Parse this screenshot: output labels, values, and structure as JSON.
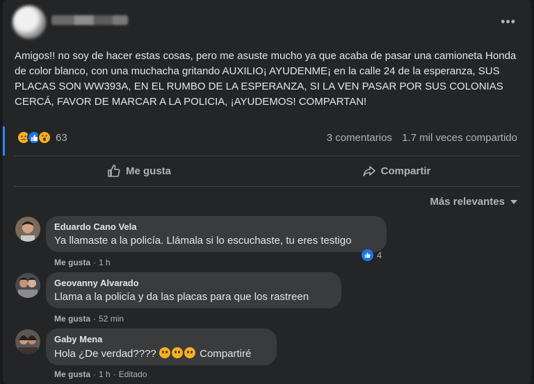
{
  "post": {
    "text": "Amigos!! no soy de hacer estas cosas, pero me asuste mucho ya que acaba de pasar una camioneta Honda de color blanco, con una muchacha gritando AUXILIO¡ AYUDENME¡ en la calle 24 de la esperanza, SUS PLACAS SON WW393A, EN EL RUMBO DE LA ESPERANZA, SI LA VEN PASAR POR SUS COLONIAS CERCÁ, FAVOR DE MARCAR A LA POLICIA, ¡AYUDEMOS! COMPARTAN!",
    "more_label": "•••",
    "reaction_count": "63",
    "comments_count": "3 comentarios",
    "shares_count": "1.7 mil veces compartido"
  },
  "actions": {
    "like_label": "Me gusta",
    "share_label": "Compartir"
  },
  "sort": {
    "label": "Más relevantes"
  },
  "comments": [
    {
      "name": "Eduardo Cano Vela",
      "text": "Ya llamaste a la policía. Llámala si lo escuchaste, tu eres testigo",
      "like": "Me gusta",
      "time": "1 h",
      "reactions": "4"
    },
    {
      "name": "Geovanny Alvarado",
      "text": "Llama a la policía y da las placas para que los rastreen",
      "like": "Me gusta",
      "time": "52 min"
    },
    {
      "name": "Gaby Mena",
      "text_before": "Hola ¿De verdad????",
      "text_after": "Compartiré",
      "like": "Me gusta",
      "time": "1 h",
      "edited": "Editado"
    }
  ],
  "colors": {
    "accent": "#2d88ff",
    "like_blue": "#1877f2",
    "emoji_yellow": "#f7b125"
  },
  "icons": [
    "more-icon",
    "sad-reaction-icon",
    "like-reaction-icon",
    "wow-reaction-icon",
    "thumbs-up-icon",
    "share-arrow-icon",
    "caret-down-icon"
  ]
}
